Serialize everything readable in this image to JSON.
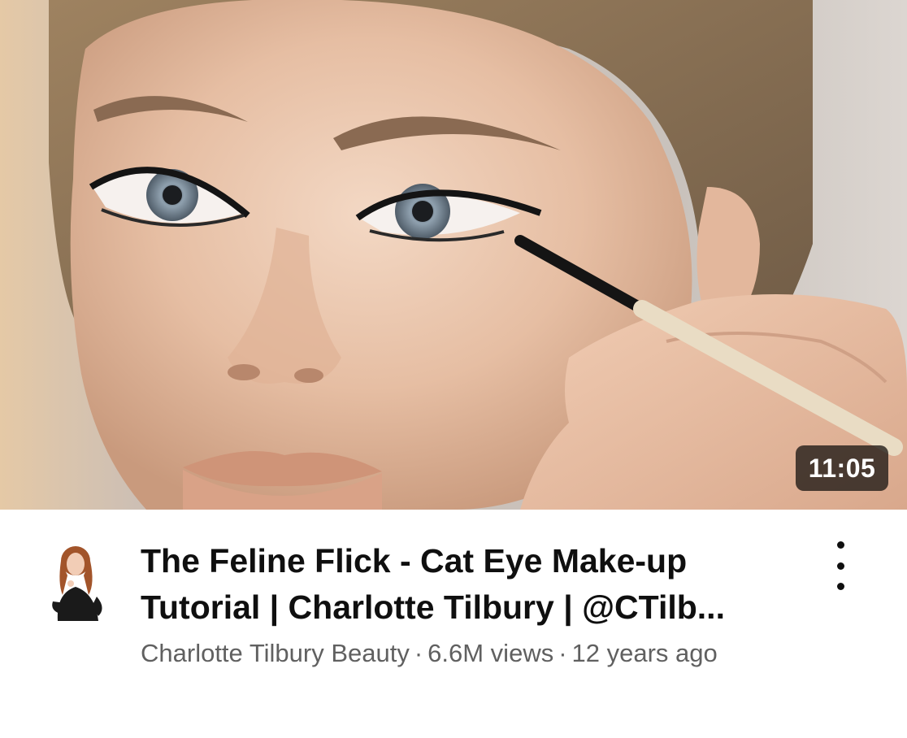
{
  "video": {
    "duration": "11:05",
    "title": "The Feline Flick - Cat Eye Make-up Tutorial | Charlotte Tilbury | @CTilb...",
    "channel": "Charlotte Tilbury Beauty",
    "separator": "·",
    "views": "6.6M views",
    "age": "12 years ago"
  },
  "icons": {
    "more": "more-vertical-icon",
    "avatar": "channel-avatar"
  },
  "colors": {
    "title": "#0f0f0f",
    "meta": "#606060",
    "badge_bg": "rgba(30,24,20,0.78)",
    "badge_text": "#ffffff"
  }
}
